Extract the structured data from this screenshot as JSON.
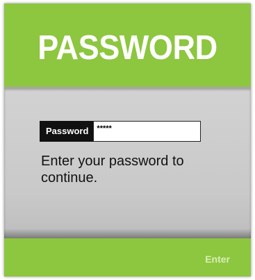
{
  "header": {
    "title": "PASSWORD"
  },
  "form": {
    "password_label": "Password",
    "password_value": "*****",
    "hint": "Enter your password to continue."
  },
  "footer": {
    "enter_label": "Enter"
  },
  "colors": {
    "accent_green": "#8dc63f",
    "panel_gray": "#cfcfcf",
    "label_black": "#111111"
  }
}
